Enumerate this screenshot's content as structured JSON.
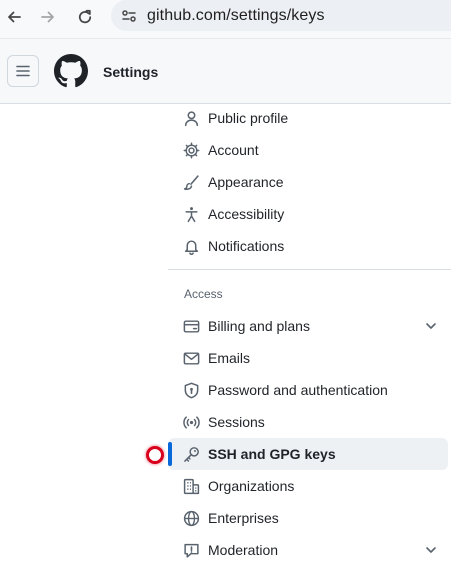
{
  "browser": {
    "url": "github.com/settings/keys"
  },
  "header": {
    "title": "Settings"
  },
  "nav": {
    "items": [
      {
        "label": "Public profile",
        "icon": "person-icon"
      },
      {
        "label": "Account",
        "icon": "gear-icon"
      },
      {
        "label": "Appearance",
        "icon": "paintbrush-icon"
      },
      {
        "label": "Accessibility",
        "icon": "accessibility-icon"
      },
      {
        "label": "Notifications",
        "icon": "bell-icon"
      }
    ],
    "access_heading": "Access",
    "access_items": [
      {
        "label": "Billing and plans",
        "icon": "credit-card-icon",
        "expandable": true
      },
      {
        "label": "Emails",
        "icon": "mail-icon"
      },
      {
        "label": "Password and authentication",
        "icon": "shield-lock-icon"
      },
      {
        "label": "Sessions",
        "icon": "broadcast-icon"
      },
      {
        "label": "SSH and GPG keys",
        "icon": "key-icon",
        "active": true
      },
      {
        "label": "Organizations",
        "icon": "organization-icon"
      },
      {
        "label": "Enterprises",
        "icon": "globe-icon"
      },
      {
        "label": "Moderation",
        "icon": "report-icon",
        "expandable": true
      }
    ]
  },
  "colors": {
    "active_indicator": "#0969da",
    "active_background": "#eef1f4",
    "click_marker": "#d9001b"
  }
}
